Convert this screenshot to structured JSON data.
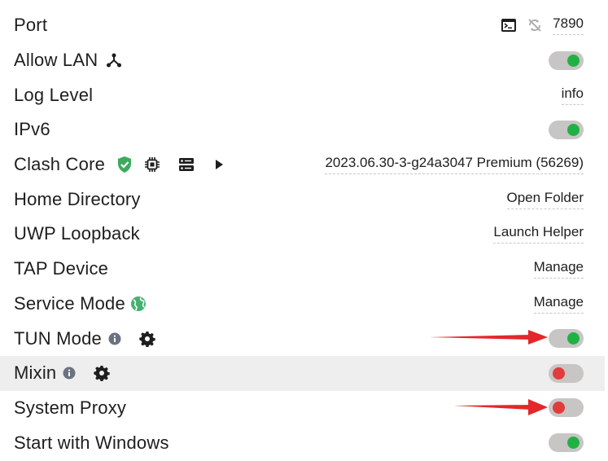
{
  "colors": {
    "toggle_on": "#1fb243",
    "toggle_off": "#e23b3b",
    "toggle_track": "#c8c5c5",
    "shield": "#3daa5f",
    "globe": "#45b070",
    "annotation_arrow": "#e4272a",
    "row_highlight": "#eeeeee"
  },
  "settings": {
    "port": {
      "label": "Port",
      "value": "7890",
      "icons": [
        "terminal-icon",
        "random-port-icon"
      ]
    },
    "allow_lan": {
      "label": "Allow LAN",
      "icon": "network-icon",
      "toggle": "on"
    },
    "log_level": {
      "label": "Log Level",
      "value": "info"
    },
    "ipv6": {
      "label": "IPv6",
      "toggle": "on"
    },
    "clash_core": {
      "label": "Clash Core",
      "icons": [
        "shield-check-icon",
        "cpu-icon",
        "server-icon",
        "play-icon"
      ],
      "value": "2023.06.30-3-g24a3047 Premium (56269)"
    },
    "home_directory": {
      "label": "Home Directory",
      "action": "Open Folder"
    },
    "uwp_loopback": {
      "label": "UWP Loopback",
      "action": "Launch Helper"
    },
    "tap_device": {
      "label": "TAP Device",
      "action": "Manage"
    },
    "service_mode": {
      "label": "Service Mode",
      "icon": "globe-icon",
      "action": "Manage"
    },
    "tun_mode": {
      "label": "TUN Mode",
      "icons": [
        "info-icon",
        "gear-icon"
      ],
      "toggle": "on"
    },
    "mixin": {
      "label": "Mixin",
      "icons": [
        "info-icon",
        "gear-icon"
      ],
      "toggle": "off",
      "highlighted": true
    },
    "system_proxy": {
      "label": "System Proxy",
      "toggle": "off"
    },
    "start_with_windows": {
      "label": "Start with Windows",
      "toggle": "on"
    }
  },
  "annotations": [
    "arrow pointing to TUN Mode toggle",
    "arrow pointing to System Proxy toggle"
  ]
}
